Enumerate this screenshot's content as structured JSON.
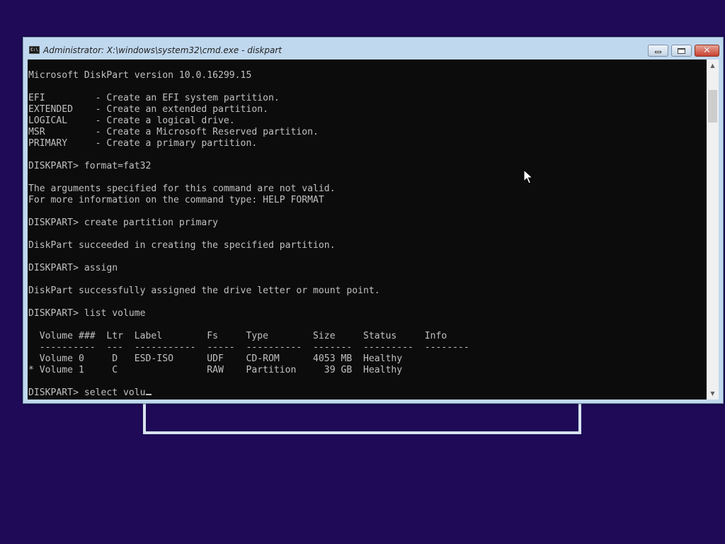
{
  "window": {
    "title": "Administrator: X:\\windows\\system32\\cmd.exe - diskpart",
    "icon_text": "C:\\",
    "controls": {
      "minimize": "minimize-icon",
      "maximize": "maximize-icon",
      "close": "close-icon",
      "close_glyph": "✕"
    }
  },
  "console": {
    "lines": [
      "Microsoft DiskPart version 10.0.16299.15",
      "",
      "EFI         - Create an EFI system partition.",
      "EXTENDED    - Create an extended partition.",
      "LOGICAL     - Create a logical drive.",
      "MSR         - Create a Microsoft Reserved partition.",
      "PRIMARY     - Create a primary partition.",
      "",
      "DISKPART> format=fat32",
      "",
      "The arguments specified for this command are not valid.",
      "For more information on the command type: HELP FORMAT",
      "",
      "DISKPART> create partition primary",
      "",
      "DiskPart succeeded in creating the specified partition.",
      "",
      "DISKPART> assign",
      "",
      "DiskPart successfully assigned the drive letter or mount point.",
      "",
      "DISKPART> list volume",
      "",
      "  Volume ###  Ltr  Label        Fs     Type        Size     Status     Info",
      "  ----------  ---  -----------  -----  ----------  -------  ---------  --------",
      "  Volume 0     D   ESD-ISO      UDF    CD-ROM      4053 MB  Healthy",
      "* Volume 1     C                RAW    Partition     39 GB  Healthy",
      ""
    ],
    "prompt": "DISKPART> ",
    "current_input": "select volu"
  },
  "scrollbar": {
    "up_glyph": "▲",
    "down_glyph": "▼"
  },
  "colors": {
    "desktop": "#1e0a57",
    "console_bg": "#0c0c0c",
    "console_text": "#c0c0c0",
    "titlebar": "#c0d8ee"
  }
}
